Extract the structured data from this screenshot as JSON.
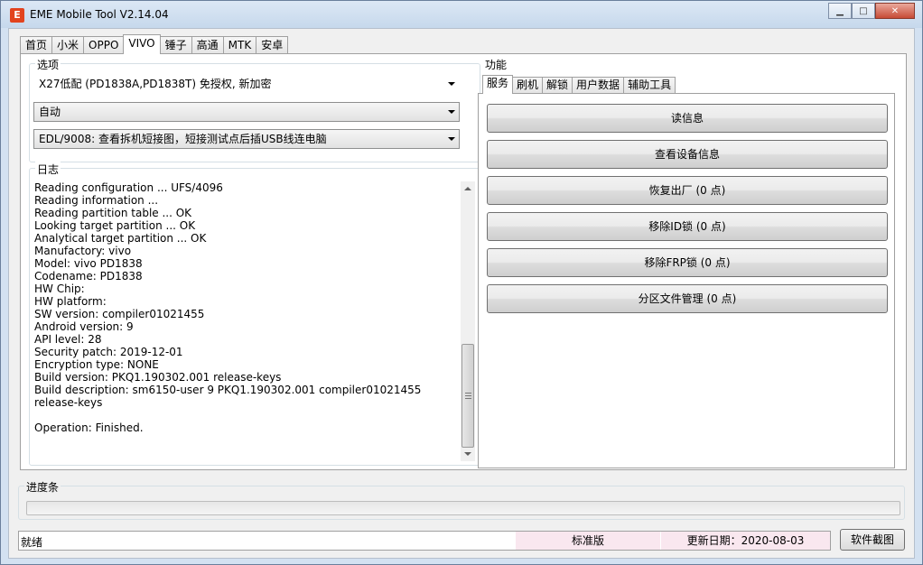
{
  "window": {
    "title": "EME Mobile Tool V2.14.04",
    "icon_glyph": "E",
    "icon_color": "#e2431e",
    "buttons": [
      "minimize",
      "maximize",
      "close"
    ]
  },
  "top_tabs": [
    "首页",
    "小米",
    "OPPO",
    "VIVO",
    "锤子",
    "高通",
    "MTK",
    "安卓"
  ],
  "active_top_tab": "VIVO",
  "options": {
    "legend": "选项",
    "model_select": "X27低配 (PD1838A,PD1838T) 免授权, 新加密",
    "mode_select": "自动",
    "edl_select": "EDL/9008: 查看拆机短接图，短接测试点后插USB线连电脑"
  },
  "log": {
    "legend": "日志",
    "lines": [
      "Reading configuration ... UFS/4096",
      "Reading information ...",
      "Reading partition table ... OK",
      "Looking target partition ... OK",
      "Analytical target partition ... OK",
      "Manufactory: vivo",
      "Model: vivo PD1838",
      "Codename: PD1838",
      "HW Chip:",
      "HW platform:",
      "SW version: compiler01021455",
      "Android version: 9",
      "API level: 28",
      "Security patch: 2019-12-01",
      "Encryption type: NONE",
      "Build version: PKQ1.190302.001 release-keys",
      "Build description: sm6150-user 9 PKQ1.190302.001 compiler01021455 release-keys",
      "",
      "Operation: Finished."
    ]
  },
  "functions": {
    "legend": "功能",
    "tabs": [
      "服务",
      "刷机",
      "解锁",
      "用户数据",
      "辅助工具"
    ],
    "active_tab": "服务",
    "buttons": [
      "读信息",
      "查看设备信息",
      "恢复出厂 (0 点)",
      "移除ID锁 (0 点)",
      "移除FRP锁 (0 点)",
      "分区文件管理 (0 点)"
    ]
  },
  "progress": {
    "legend": "进度条",
    "value": 0
  },
  "status_bar": {
    "status": "就绪",
    "edition": "标准版",
    "update_date": "更新日期：2020-08-03",
    "screenshot_button": "软件截图"
  }
}
